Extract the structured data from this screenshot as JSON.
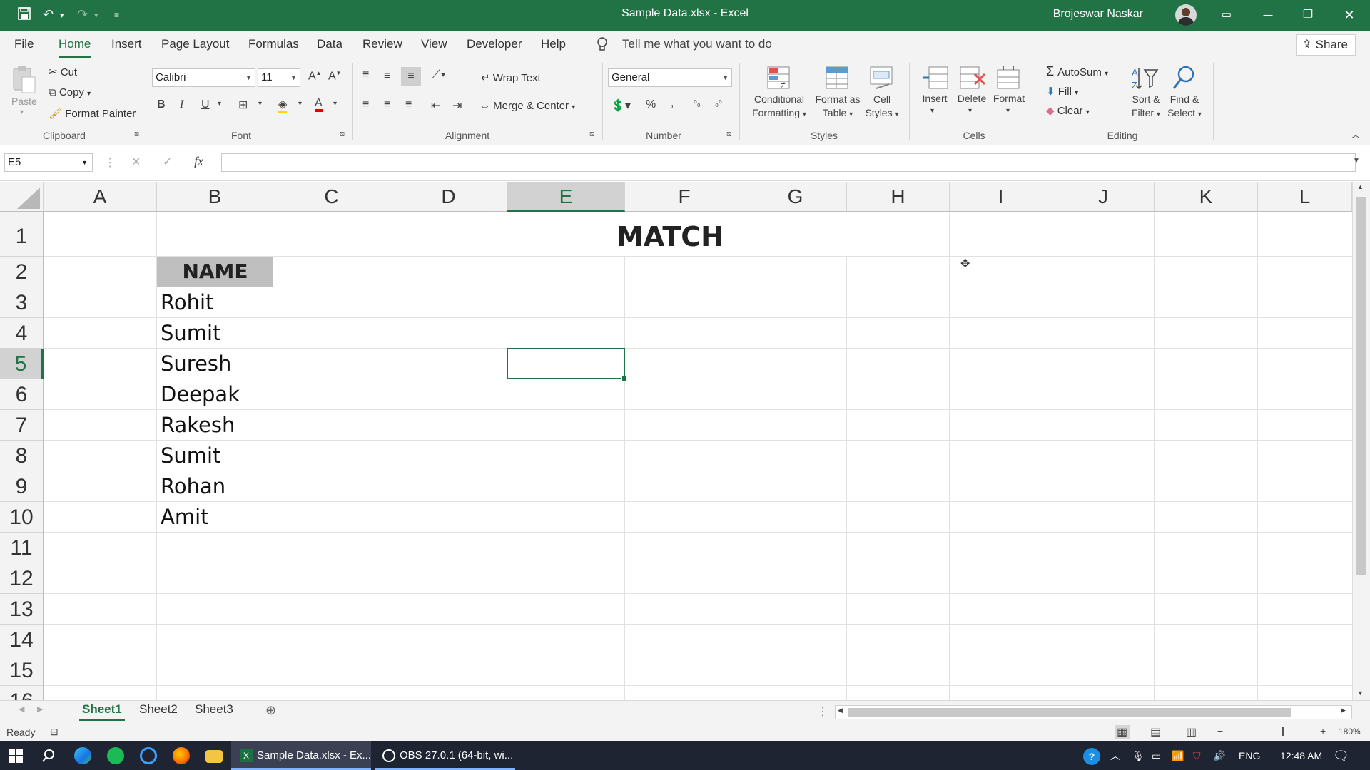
{
  "window": {
    "title": "Sample Data.xlsx  -  Excel",
    "user": "Brojeswar Naskar"
  },
  "quick_access": {
    "save_icon": "save-icon",
    "undo_icon": "undo-icon",
    "redo_icon": "redo-icon"
  },
  "menu": {
    "tabs": [
      "File",
      "Home",
      "Insert",
      "Page Layout",
      "Formulas",
      "Data",
      "Review",
      "View",
      "Developer",
      "Help"
    ],
    "active": "Home",
    "tell_me": "Tell me what you want to do",
    "share": "Share"
  },
  "ribbon": {
    "clipboard": {
      "paste": "Paste",
      "cut": "Cut",
      "copy": "Copy",
      "format_painter": "Format Painter",
      "label": "Clipboard"
    },
    "font": {
      "name": "Calibri",
      "size": "11",
      "label": "Font"
    },
    "alignment": {
      "wrap_text": "Wrap Text",
      "merge_center": "Merge & Center",
      "label": "Alignment"
    },
    "number": {
      "format": "General",
      "label": "Number"
    },
    "styles": {
      "conditional_formatting": [
        "Conditional",
        "Formatting"
      ],
      "format_as_table": [
        "Format as",
        "Table"
      ],
      "cell_styles": [
        "Cell",
        "Styles"
      ],
      "label": "Styles"
    },
    "cells": {
      "insert": "Insert",
      "delete": "Delete",
      "format": "Format",
      "label": "Cells"
    },
    "editing": {
      "autosum": "AutoSum",
      "fill": "Fill",
      "clear": "Clear",
      "sort_filter": [
        "Sort &",
        "Filter"
      ],
      "find_select": [
        "Find &",
        "Select"
      ],
      "label": "Editing"
    }
  },
  "formula_bar": {
    "name_box": "E5",
    "formula": ""
  },
  "sheet": {
    "columns": [
      "A",
      "B",
      "C",
      "D",
      "E",
      "F",
      "G",
      "H",
      "I",
      "J",
      "K",
      "L"
    ],
    "selected_column": "E",
    "rows": [
      "1",
      "2",
      "3",
      "4",
      "5",
      "6",
      "7",
      "8",
      "9",
      "10",
      "11",
      "12",
      "13",
      "14",
      "15",
      "16"
    ],
    "selected_row": "5",
    "title": "MATCH",
    "header": "NAME",
    "names": [
      "Rohit",
      "Sumit",
      "Suresh",
      "Deepak",
      "Rakesh",
      "Sumit",
      "Rohan",
      "Amit"
    ]
  },
  "sheet_tabs": [
    "Sheet1",
    "Sheet2",
    "Sheet3"
  ],
  "active_sheet": "Sheet1",
  "status": {
    "ready": "Ready",
    "zoom": "180%"
  },
  "taskbar": {
    "apps": [
      "Sample Data.xlsx - Ex...",
      "OBS 27.0.1 (64-bit, wi..."
    ],
    "language": "ENG",
    "time": "12:48 AM"
  }
}
